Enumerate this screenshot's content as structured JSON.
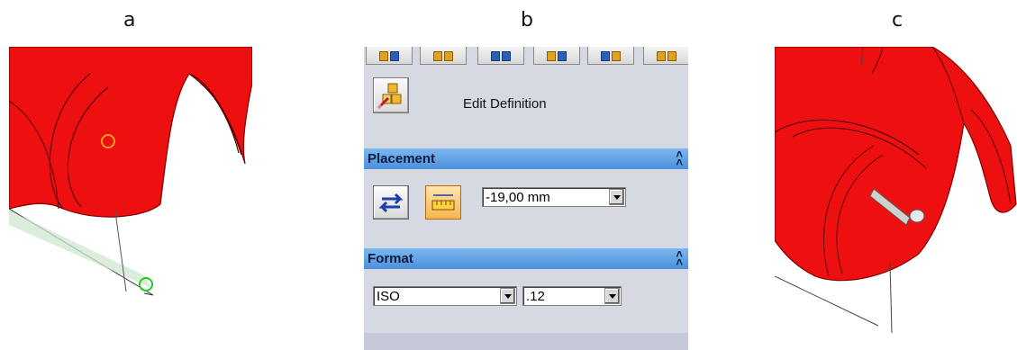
{
  "labels": {
    "a": "a",
    "b": "b",
    "c": "c"
  },
  "panel": {
    "edit_definition": "Edit Definition",
    "placement": {
      "title": "Placement",
      "distance_value": "-19,00 mm"
    },
    "format": {
      "title": "Format",
      "standard_value": "ISO",
      "precision_value": ".12"
    },
    "toolbar_icons": [
      "sketch-icon",
      "select-icon",
      "pattern-icon",
      "select-icon",
      "sketch-icon",
      "pattern-icon"
    ]
  },
  "colors": {
    "part_red": "#ee1010",
    "header_blue": "#5a9be3",
    "panel_bg": "#d6d9e2",
    "sketch_orange": "#f0a020",
    "sketch_green": "#22cc22"
  }
}
